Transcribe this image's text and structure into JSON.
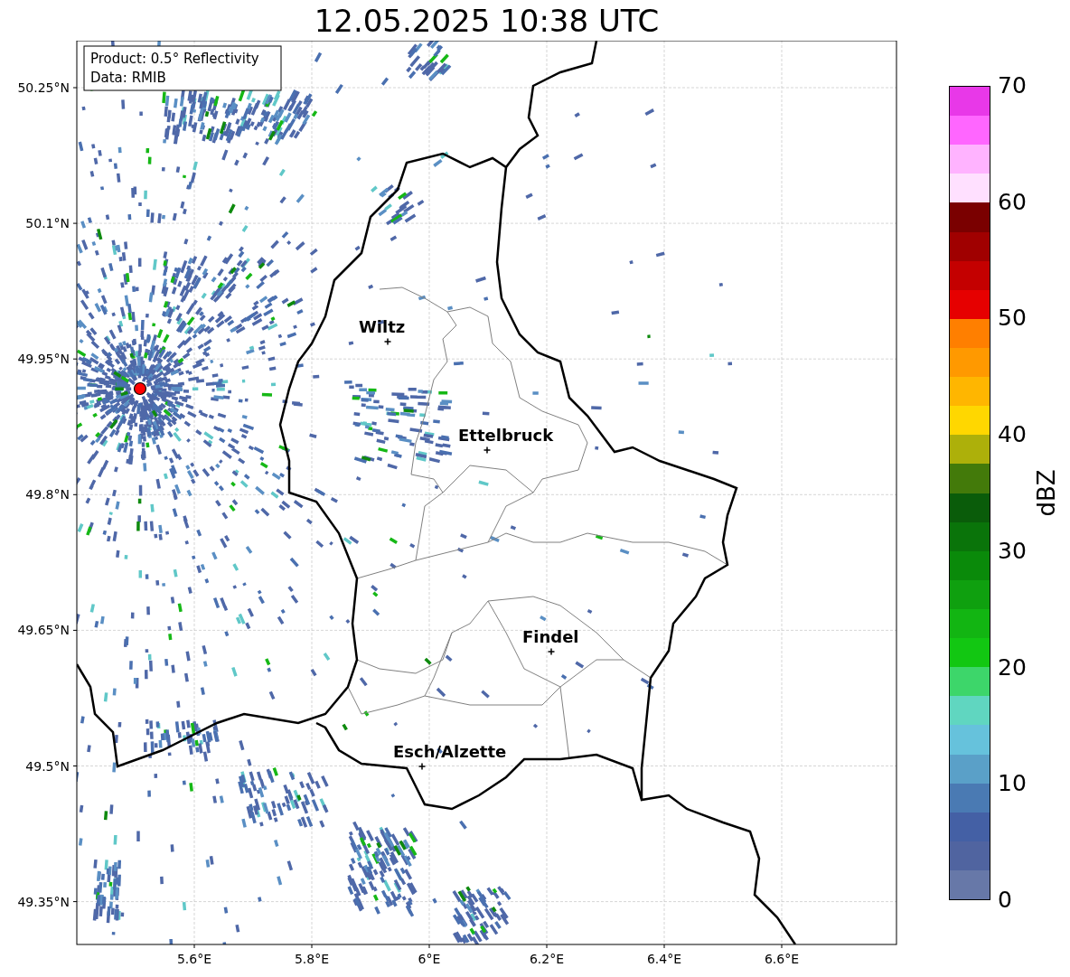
{
  "title": "12.05.2025 10:38 UTC",
  "map": {
    "legend_lines": [
      "Product: 0.5° Reflectivity",
      "Data: RMIB"
    ],
    "x_tick_labels": [
      "5.6°E",
      "5.8°E",
      "6°E",
      "6.2°E",
      "6.4°E",
      "6.6°E"
    ],
    "y_tick_labels": [
      "50.25°N",
      "50.1°N",
      "49.95°N",
      "49.8°N",
      "49.65°N",
      "49.5°N",
      "49.35°N"
    ],
    "places": [
      {
        "name": "Wiltz"
      },
      {
        "name": "Ettelbruck"
      },
      {
        "name": "Findel"
      },
      {
        "name": "Esch/Alzette"
      }
    ]
  },
  "colorbar": {
    "label": "dBZ",
    "ticks": [
      "70",
      "60",
      "50",
      "40",
      "30",
      "20",
      "10",
      "0"
    ],
    "bins": [
      {
        "color": "#e838e8"
      },
      {
        "color": "#ff66ff"
      },
      {
        "color": "#ffb3ff"
      },
      {
        "color": "#ffe0ff"
      },
      {
        "color": "#7a0000"
      },
      {
        "color": "#a00000"
      },
      {
        "color": "#c40000"
      },
      {
        "color": "#e60000"
      },
      {
        "color": "#ff7f00"
      },
      {
        "color": "#ff9900"
      },
      {
        "color": "#ffb600"
      },
      {
        "color": "#ffd700"
      },
      {
        "color": "#adb00a"
      },
      {
        "color": "#437a0a"
      },
      {
        "color": "#0a5c0a"
      },
      {
        "color": "#0a740a"
      },
      {
        "color": "#0a8a0a"
      },
      {
        "color": "#0fa00f"
      },
      {
        "color": "#12b512"
      },
      {
        "color": "#12c712"
      },
      {
        "color": "#3dd66a"
      },
      {
        "color": "#60d6c0"
      },
      {
        "color": "#66c2dc"
      },
      {
        "color": "#5aa0c8"
      },
      {
        "color": "#4a7ab3"
      },
      {
        "color": "#4460a5"
      },
      {
        "color": "#5064a0"
      },
      {
        "color": "#6778a8"
      }
    ]
  }
}
